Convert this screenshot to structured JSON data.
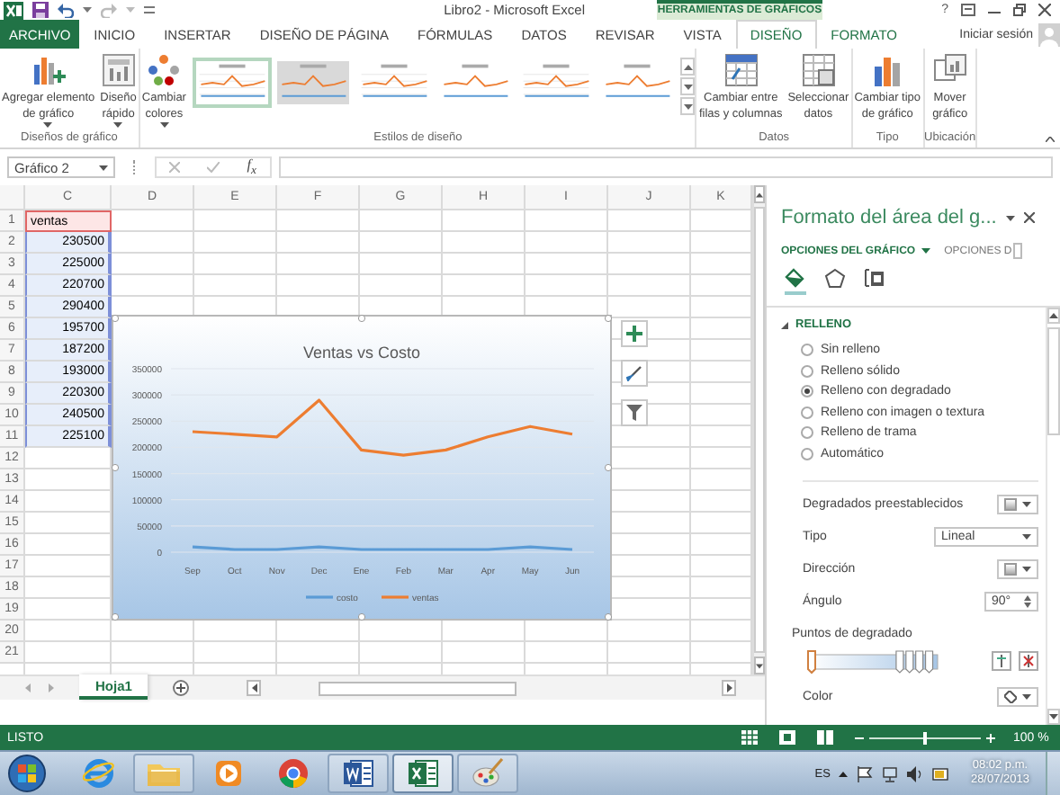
{
  "title_bar": {
    "title": "Libro2 - Microsoft Excel",
    "context_label": "HERRAMIENTAS DE GRÁFICOS",
    "help": "?"
  },
  "tabs": [
    {
      "label": "ARCHIVO",
      "kind": "file",
      "selected": false
    },
    {
      "label": "INICIO",
      "kind": "normal",
      "selected": false
    },
    {
      "label": "INSERTAR",
      "kind": "normal",
      "selected": false
    },
    {
      "label": "DISEÑO DE PÁGINA",
      "kind": "normal",
      "selected": false
    },
    {
      "label": "FÓRMULAS",
      "kind": "normal",
      "selected": false
    },
    {
      "label": "DATOS",
      "kind": "normal",
      "selected": false
    },
    {
      "label": "REVISAR",
      "kind": "normal",
      "selected": false
    },
    {
      "label": "VISTA",
      "kind": "normal",
      "selected": false
    },
    {
      "label": "DISEÑO",
      "kind": "context",
      "selected": true
    },
    {
      "label": "FORMATO",
      "kind": "context",
      "selected": false
    }
  ],
  "account": {
    "label": "Iniciar sesión"
  },
  "ribbon": {
    "groups": [
      {
        "label": "Diseños de gráfico",
        "buttons": [
          {
            "lines": [
              "Agregar elemento",
              "de gráfico"
            ],
            "dropdown": true
          },
          {
            "lines": [
              "Diseño",
              "rápido"
            ],
            "dropdown": true
          }
        ]
      },
      {
        "label": "Estilos de diseño",
        "buttons": [
          {
            "lines": [
              "Cambiar",
              "colores"
            ],
            "dropdown": true
          }
        ],
        "styles": [
          {
            "selected": true
          },
          {
            "selected": false
          },
          {
            "selected": false
          },
          {
            "selected": false
          },
          {
            "selected": false
          },
          {
            "selected": false
          }
        ]
      },
      {
        "label": "Datos",
        "buttons": [
          {
            "lines": [
              "Cambiar entre",
              "filas y columnas"
            ],
            "dropdown": false
          },
          {
            "lines": [
              "Seleccionar",
              "datos"
            ],
            "dropdown": false
          }
        ]
      },
      {
        "label": "Tipo",
        "buttons": [
          {
            "lines": [
              "Cambiar tipo",
              "de gráfico"
            ],
            "dropdown": false
          }
        ]
      },
      {
        "label": "Ubicación",
        "buttons": [
          {
            "lines": [
              "Mover",
              "gráfico"
            ],
            "dropdown": false
          }
        ]
      }
    ]
  },
  "formula_bar": {
    "name_box": "Gráfico 2",
    "function_label": "f$_{x}$"
  },
  "sheet": {
    "columns": [
      "C",
      "D",
      "E",
      "F",
      "G",
      "H",
      "I",
      "J",
      "K"
    ],
    "rows": [
      {
        "number": "1",
        "value": "ventas",
        "kind": "name"
      },
      {
        "number": "2",
        "value": "230500",
        "kind": "values"
      },
      {
        "number": "3",
        "value": "225000",
        "kind": "values"
      },
      {
        "number": "4",
        "value": "220700",
        "kind": "values"
      },
      {
        "number": "5",
        "value": "290400",
        "kind": "values"
      },
      {
        "number": "6",
        "value": "195700",
        "kind": "values"
      },
      {
        "number": "7",
        "value": "187200",
        "kind": "values"
      },
      {
        "number": "8",
        "value": "193000",
        "kind": "values"
      },
      {
        "number": "9",
        "value": "220300",
        "kind": "values"
      },
      {
        "number": "10",
        "value": "240500",
        "kind": "values"
      },
      {
        "number": "11",
        "value": "225100",
        "kind": "values"
      },
      {
        "number": "12",
        "kind": "empty"
      },
      {
        "number": "13",
        "kind": "empty"
      },
      {
        "number": "14",
        "kind": "empty"
      },
      {
        "number": "15",
        "kind": "empty"
      },
      {
        "number": "16",
        "kind": "empty"
      },
      {
        "number": "17",
        "kind": "empty"
      },
      {
        "number": "18",
        "kind": "empty"
      },
      {
        "number": "19",
        "kind": "empty"
      },
      {
        "number": "20",
        "kind": "empty"
      },
      {
        "number": "21",
        "kind": "empty"
      }
    ]
  },
  "chart": {
    "chart_data": {
      "type": "line",
      "title": "Ventas vs Costo",
      "categories": [
        "Sep",
        "Oct",
        "Nov",
        "Dec",
        "Ene",
        "Feb",
        "Mar",
        "Apr",
        "May",
        "Jun"
      ],
      "series": [
        {
          "name": "costo",
          "color": "#5b9bd5",
          "values": [
            10000,
            5000,
            5000,
            10000,
            5000,
            5000,
            5000,
            5000,
            10000,
            5000
          ]
        },
        {
          "name": "ventas",
          "color": "#ed7d31",
          "values": [
            230000,
            225000,
            220000,
            290000,
            195000,
            185000,
            195000,
            220000,
            240000,
            225000
          ]
        }
      ],
      "ylim": [
        0,
        350000
      ],
      "yticks": [
        0,
        50000,
        100000,
        150000,
        200000,
        250000,
        300000,
        350000
      ],
      "grid": true,
      "legend": true
    }
  },
  "sheet_tabs": [
    {
      "label": "Hoja1",
      "selected": true
    }
  ],
  "pane": {
    "title": "Formato del área del g...",
    "tabs": [
      {
        "label": "OPCIONES DEL GRÁFICO",
        "selected": true,
        "dropdown": true
      },
      {
        "label": "OPCIONES D",
        "selected": false,
        "dropdown": false
      }
    ],
    "icon_tabs": [
      {
        "selected": true
      },
      {
        "selected": false
      },
      {
        "selected": false
      }
    ],
    "section": {
      "label": "RELLENO",
      "expanded": true
    },
    "fill_options": [
      {
        "label": "Sin relleno",
        "selected": false
      },
      {
        "label": "Relleno sólido",
        "selected": false
      },
      {
        "label": "Relleno con degradado",
        "selected": true
      },
      {
        "label": "Relleno con imagen o textura",
        "selected": false
      },
      {
        "label": "Relleno de trama",
        "selected": false
      },
      {
        "label": "Automático",
        "selected": false
      }
    ],
    "settings": [
      {
        "kind": "swatch",
        "label": "Degradados preestablecidos"
      },
      {
        "kind": "select",
        "label": "Tipo",
        "value": "Lineal"
      },
      {
        "kind": "swatch",
        "label": "Dirección"
      },
      {
        "kind": "spin",
        "label": "Ángulo",
        "value": "90°"
      },
      {
        "kind": "heading",
        "label": "Puntos de degradado"
      },
      {
        "kind": "stops",
        "stops": [
          {
            "level": 0,
            "selected": true
          },
          {
            "level": 0.72,
            "selected": false
          },
          {
            "level": 0.8,
            "selected": false
          },
          {
            "level": 0.88,
            "selected": false
          },
          {
            "level": 0.96,
            "selected": false
          }
        ]
      },
      {
        "kind": "color",
        "label": "Color"
      }
    ]
  },
  "status_bar": {
    "status": "LISTO",
    "zoom_slider": {
      "level": 0.5
    },
    "zoom": "100 %"
  },
  "taskbar": {
    "apps": [
      {
        "kind": "ie",
        "running": false,
        "selected": false
      },
      {
        "kind": "folder",
        "running": true,
        "selected": false
      },
      {
        "kind": "media",
        "running": false,
        "selected": false
      },
      {
        "kind": "chrome",
        "running": false,
        "selected": false
      },
      {
        "kind": "word",
        "running": true,
        "selected": false
      },
      {
        "kind": "excel",
        "running": true,
        "selected": true
      },
      {
        "kind": "paint",
        "running": true,
        "selected": false
      }
    ],
    "language": "ES",
    "time": "08:02 p.m.",
    "date": "28/07/2013"
  }
}
